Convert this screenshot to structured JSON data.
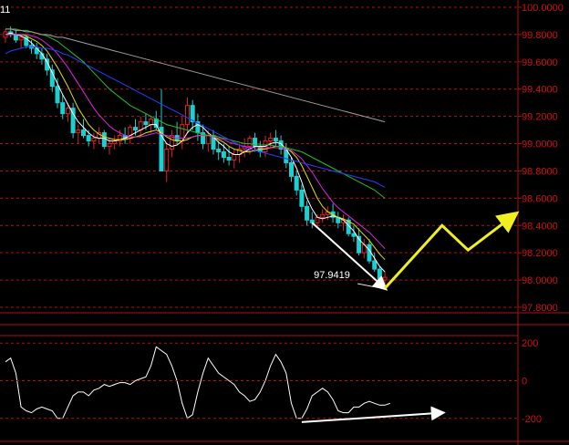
{
  "colors": {
    "background": "#000000",
    "grid": "#b01010",
    "axis_text": "#d01010",
    "candle_up": "#e02020",
    "candle_down": "#1ad0d0",
    "ma_white": "#ffffff",
    "ma_yellow": "#e8e000",
    "ma_magenta": "#e020e0",
    "ma_green": "#20c020",
    "ma_blue": "#2040ff",
    "ma_gray": "#a0a0a0",
    "annotation_white": "#ffffff",
    "annotation_yellow": "#f0f020"
  },
  "chart_data": [
    {
      "type": "candlestick",
      "title": "",
      "corner_label": "11",
      "ylim": [
        97.8,
        100.0
      ],
      "yticks": [
        "100.0000",
        "99.8000",
        "99.6000",
        "99.4000",
        "99.2000",
        "99.0000",
        "98.8000",
        "98.6000",
        "98.4000",
        "98.2000",
        "98.0000",
        "97.8000"
      ],
      "ohlc": [
        [
          99.78,
          99.84,
          99.74,
          99.82
        ],
        [
          99.82,
          99.86,
          99.78,
          99.8
        ],
        [
          99.8,
          99.84,
          99.74,
          99.76
        ],
        [
          99.76,
          99.8,
          99.7,
          99.78
        ],
        [
          99.78,
          99.8,
          99.7,
          99.72
        ],
        [
          99.72,
          99.76,
          99.66,
          99.7
        ],
        [
          99.7,
          99.74,
          99.62,
          99.66
        ],
        [
          99.66,
          99.7,
          99.58,
          99.62
        ],
        [
          99.62,
          99.66,
          99.5,
          99.54
        ],
        [
          99.54,
          99.58,
          99.38,
          99.42
        ],
        [
          99.42,
          99.48,
          99.26,
          99.3
        ],
        [
          99.3,
          99.36,
          99.18,
          99.22
        ],
        [
          99.22,
          99.3,
          99.16,
          99.26
        ],
        [
          99.26,
          99.3,
          99.04,
          99.08
        ],
        [
          99.08,
          99.14,
          99.0,
          99.1
        ],
        [
          99.1,
          99.18,
          99.04,
          99.06
        ],
        [
          99.06,
          99.1,
          98.98,
          99.02
        ],
        [
          99.02,
          99.08,
          98.96,
          99.04
        ],
        [
          99.04,
          99.12,
          99.0,
          99.08
        ],
        [
          99.08,
          99.1,
          98.96,
          98.98
        ],
        [
          98.98,
          99.04,
          98.92,
          99.0
        ],
        [
          99.0,
          99.06,
          98.96,
          99.02
        ],
        [
          99.02,
          99.1,
          98.98,
          99.06
        ],
        [
          99.06,
          99.12,
          99.0,
          99.04
        ],
        [
          99.04,
          99.14,
          99.0,
          99.12
        ],
        [
          99.12,
          99.18,
          99.06,
          99.1
        ],
        [
          99.1,
          99.2,
          99.06,
          99.16
        ],
        [
          99.16,
          99.22,
          99.1,
          99.14
        ],
        [
          99.14,
          99.2,
          99.08,
          99.18
        ],
        [
          99.18,
          99.24,
          99.1,
          99.12
        ],
        [
          99.12,
          99.4,
          98.9,
          98.8
        ],
        [
          98.8,
          99.0,
          98.72,
          98.96
        ],
        [
          98.96,
          99.1,
          98.9,
          99.06
        ],
        [
          99.06,
          99.16,
          99.0,
          99.02
        ],
        [
          99.02,
          99.2,
          98.96,
          99.14
        ],
        [
          99.14,
          99.34,
          99.08,
          99.28
        ],
        [
          99.28,
          99.32,
          99.1,
          99.16
        ],
        [
          99.16,
          99.22,
          99.02,
          99.08
        ],
        [
          99.08,
          99.14,
          98.96,
          99.0
        ],
        [
          99.0,
          99.1,
          98.94,
          99.06
        ],
        [
          99.06,
          99.1,
          98.92,
          98.96
        ],
        [
          98.96,
          99.02,
          98.88,
          98.94
        ],
        [
          98.94,
          99.0,
          98.86,
          98.9
        ],
        [
          98.9,
          98.98,
          98.84,
          98.88
        ],
        [
          98.88,
          98.96,
          98.82,
          98.92
        ],
        [
          98.92,
          99.0,
          98.86,
          98.96
        ],
        [
          98.96,
          99.04,
          98.9,
          98.98
        ],
        [
          98.98,
          99.06,
          98.92,
          99.04
        ],
        [
          99.04,
          99.08,
          98.94,
          98.98
        ],
        [
          98.98,
          99.02,
          98.9,
          98.94
        ],
        [
          98.94,
          99.06,
          98.9,
          99.02
        ],
        [
          99.02,
          99.08,
          98.96,
          99.04
        ],
        [
          99.04,
          99.1,
          98.98,
          99.02
        ],
        [
          99.02,
          99.06,
          98.92,
          98.96
        ],
        [
          98.96,
          99.0,
          98.82,
          98.86
        ],
        [
          98.86,
          98.9,
          98.72,
          98.76
        ],
        [
          98.76,
          98.8,
          98.62,
          98.66
        ],
        [
          98.66,
          98.7,
          98.5,
          98.54
        ],
        [
          98.54,
          98.58,
          98.4,
          98.44
        ],
        [
          98.44,
          98.5,
          98.38,
          98.42
        ],
        [
          98.42,
          98.48,
          98.38,
          98.46
        ],
        [
          98.46,
          98.52,
          98.42,
          98.48
        ],
        [
          98.48,
          98.54,
          98.44,
          98.5
        ],
        [
          98.5,
          98.56,
          98.42,
          98.46
        ],
        [
          98.46,
          98.5,
          98.38,
          98.42
        ],
        [
          98.42,
          98.48,
          98.36,
          98.44
        ],
        [
          98.44,
          98.46,
          98.32,
          98.34
        ],
        [
          98.34,
          98.4,
          98.28,
          98.32
        ],
        [
          98.32,
          98.38,
          98.18,
          98.2
        ],
        [
          98.2,
          98.3,
          98.16,
          98.26
        ],
        [
          98.26,
          98.3,
          98.12,
          98.14
        ],
        [
          98.14,
          98.2,
          98.06,
          98.08
        ],
        [
          98.08,
          98.1,
          97.98,
          98.0
        ],
        [
          98.0,
          98.06,
          97.96,
          98.02
        ]
      ],
      "moving_averages": [
        {
          "color_key": "ma_white",
          "values": [
            99.8,
            99.81,
            99.8,
            99.79,
            99.77,
            99.74,
            99.7,
            99.66,
            99.6,
            99.52,
            99.44,
            99.36,
            99.29,
            99.22,
            99.16,
            99.12,
            99.08,
            99.05,
            99.04,
            99.04,
            99.02,
            99.02,
            99.03,
            99.04,
            99.06,
            99.08,
            99.1,
            99.12,
            99.14,
            99.14,
            99.06,
            99.0,
            98.98,
            98.99,
            99.02,
            99.08,
            99.12,
            99.14,
            99.12,
            99.08,
            99.05,
            99.01,
            98.98,
            98.94,
            98.92,
            98.92,
            98.94,
            98.96,
            98.98,
            98.98,
            98.98,
            99.0,
            99.01,
            99.0,
            98.96,
            98.9,
            98.82,
            98.72,
            98.6,
            98.52,
            98.46,
            98.45,
            98.46,
            98.47,
            98.46,
            98.44,
            98.4,
            98.36,
            98.3,
            98.26,
            98.22,
            98.16,
            98.1,
            98.06
          ]
        },
        {
          "color_key": "ma_yellow",
          "values": [
            99.8,
            99.8,
            99.8,
            99.8,
            99.79,
            99.77,
            99.75,
            99.72,
            99.68,
            99.62,
            99.56,
            99.49,
            99.42,
            99.34,
            99.26,
            99.2,
            99.14,
            99.1,
            99.07,
            99.05,
            99.04,
            99.03,
            99.03,
            99.03,
            99.04,
            99.05,
            99.06,
            99.08,
            99.09,
            99.1,
            99.08,
            99.05,
            99.03,
            99.02,
            99.02,
            99.03,
            99.05,
            99.06,
            99.06,
            99.06,
            99.05,
            99.03,
            99.01,
            98.98,
            98.96,
            98.95,
            98.94,
            98.94,
            98.95,
            98.96,
            98.96,
            98.97,
            98.98,
            98.98,
            98.97,
            98.94,
            98.9,
            98.84,
            98.76,
            98.68,
            98.6,
            98.54,
            98.5,
            98.48,
            98.46,
            98.45,
            98.43,
            98.41,
            98.37,
            98.33,
            98.29,
            98.24,
            98.19,
            98.15
          ]
        },
        {
          "color_key": "ma_magenta",
          "values": [
            99.8,
            99.8,
            99.8,
            99.8,
            99.8,
            99.79,
            99.78,
            99.76,
            99.73,
            99.7,
            99.66,
            99.61,
            99.56,
            99.5,
            99.44,
            99.38,
            99.32,
            99.26,
            99.21,
            99.17,
            99.13,
            99.1,
            99.08,
            99.06,
            99.05,
            99.05,
            99.05,
            99.06,
            99.07,
            99.08,
            99.07,
            99.06,
            99.05,
            99.04,
            99.04,
            99.04,
            99.05,
            99.06,
            99.06,
            99.06,
            99.05,
            99.04,
            99.03,
            99.01,
            99.0,
            98.99,
            98.98,
            98.97,
            98.97,
            98.97,
            98.97,
            98.97,
            98.97,
            98.97,
            98.96,
            98.95,
            98.92,
            98.89,
            98.84,
            98.79,
            98.73,
            98.67,
            98.62,
            98.57,
            98.53,
            98.5,
            98.47,
            98.44,
            98.41,
            98.38,
            98.35,
            98.31,
            98.27,
            98.23
          ]
        },
        {
          "color_key": "ma_green",
          "values": [
            99.84,
            99.84,
            99.84,
            99.83,
            99.83,
            99.82,
            99.81,
            99.8,
            99.79,
            99.77,
            99.75,
            99.72,
            99.69,
            99.66,
            99.63,
            99.6,
            99.56,
            99.52,
            99.48,
            99.44,
            99.4,
            99.37,
            99.34,
            99.31,
            99.28,
            99.26,
            99.24,
            99.22,
            99.2,
            99.18,
            99.16,
            99.14,
            99.13,
            99.12,
            99.11,
            99.1,
            99.09,
            99.08,
            99.07,
            99.06,
            99.06,
            99.05,
            99.04,
            99.03,
            99.02,
            99.01,
            99.0,
            99.0,
            98.99,
            98.99,
            98.99,
            98.99,
            98.98,
            98.98,
            98.97,
            98.96,
            98.95,
            98.94,
            98.92,
            98.9,
            98.88,
            98.86,
            98.84,
            98.82,
            98.8,
            98.78,
            98.76,
            98.74,
            98.72,
            98.7,
            98.68,
            98.66,
            98.63,
            98.6
          ]
        },
        {
          "color_key": "ma_blue",
          "values": [
            99.66,
            99.68,
            99.69,
            99.7,
            99.71,
            99.71,
            99.71,
            99.7,
            99.7,
            99.69,
            99.68,
            99.66,
            99.65,
            99.63,
            99.61,
            99.59,
            99.57,
            99.55,
            99.53,
            99.51,
            99.49,
            99.47,
            99.45,
            99.43,
            99.41,
            99.39,
            99.37,
            99.35,
            99.33,
            99.31,
            99.29,
            99.27,
            99.25,
            99.23,
            99.21,
            99.19,
            99.17,
            99.15,
            99.13,
            99.11,
            99.09,
            99.07,
            99.05,
            99.03,
            99.01,
            98.99,
            98.97,
            98.96,
            98.95,
            98.94,
            98.93,
            98.92,
            98.91,
            98.9,
            98.89,
            98.88,
            98.87,
            98.86,
            98.85,
            98.84,
            98.83,
            98.82,
            98.81,
            98.8,
            98.79,
            98.78,
            98.77,
            98.76,
            98.75,
            98.74,
            98.73,
            98.72,
            98.7,
            98.68
          ]
        },
        {
          "color_key": "ma_gray",
          "values": [
            99.84,
            99.84,
            99.83,
            99.83,
            99.82,
            99.82,
            99.81,
            99.8,
            99.8,
            99.79,
            99.78,
            99.78,
            99.77,
            99.76,
            99.75,
            99.74,
            99.73,
            99.72,
            99.71,
            99.7,
            99.69,
            99.68,
            99.67,
            99.66,
            99.65,
            99.64,
            99.63,
            99.62,
            99.61,
            99.6,
            99.59,
            99.58,
            99.57,
            99.56,
            99.55,
            99.54,
            99.53,
            99.52,
            99.51,
            99.5,
            99.49,
            99.48,
            99.47,
            99.46,
            99.45,
            99.44,
            99.43,
            99.42,
            99.41,
            99.4,
            99.39,
            99.38,
            99.37,
            99.36,
            99.35,
            99.34,
            99.33,
            99.32,
            99.31,
            99.3,
            99.29,
            99.28,
            99.27,
            99.26,
            99.25,
            99.24,
            99.23,
            99.22,
            99.21,
            99.2,
            99.19,
            99.18,
            99.17,
            99.16
          ]
        }
      ],
      "annotations": {
        "low_label": "97.9419",
        "divergence_line": {
          "from": [
            59,
            98.42
          ],
          "to": [
            73,
            97.94
          ]
        },
        "forecast_zigzag": [
          [
            73,
            97.94
          ],
          [
            84,
            98.4
          ],
          [
            89,
            98.22
          ],
          [
            98,
            98.48
          ]
        ]
      }
    },
    {
      "type": "line",
      "title": "",
      "ylim": [
        -230,
        230
      ],
      "yticks": [
        "200",
        "0",
        "-200"
      ],
      "values": [
        100,
        120,
        40,
        -140,
        -160,
        -170,
        -150,
        -140,
        -150,
        -160,
        -200,
        -200,
        -140,
        -80,
        -60,
        -60,
        -80,
        -50,
        -40,
        -20,
        -30,
        -20,
        -10,
        -10,
        -20,
        0,
        10,
        20,
        80,
        180,
        160,
        140,
        80,
        0,
        -120,
        -200,
        -180,
        -60,
        40,
        120,
        80,
        40,
        20,
        0,
        -20,
        -60,
        -80,
        -110,
        -100,
        -60,
        0,
        80,
        140,
        100,
        40,
        -120,
        -200,
        -200,
        -150,
        -80,
        -60,
        -40,
        -60,
        -100,
        -160,
        -170,
        -170,
        -140,
        -140,
        -120,
        -110,
        -120,
        -130,
        -130,
        -120
      ],
      "annotations": {
        "divergence_line": {
          "from": [
            57,
            -220
          ],
          "to": [
            84,
            -170
          ]
        }
      }
    }
  ]
}
